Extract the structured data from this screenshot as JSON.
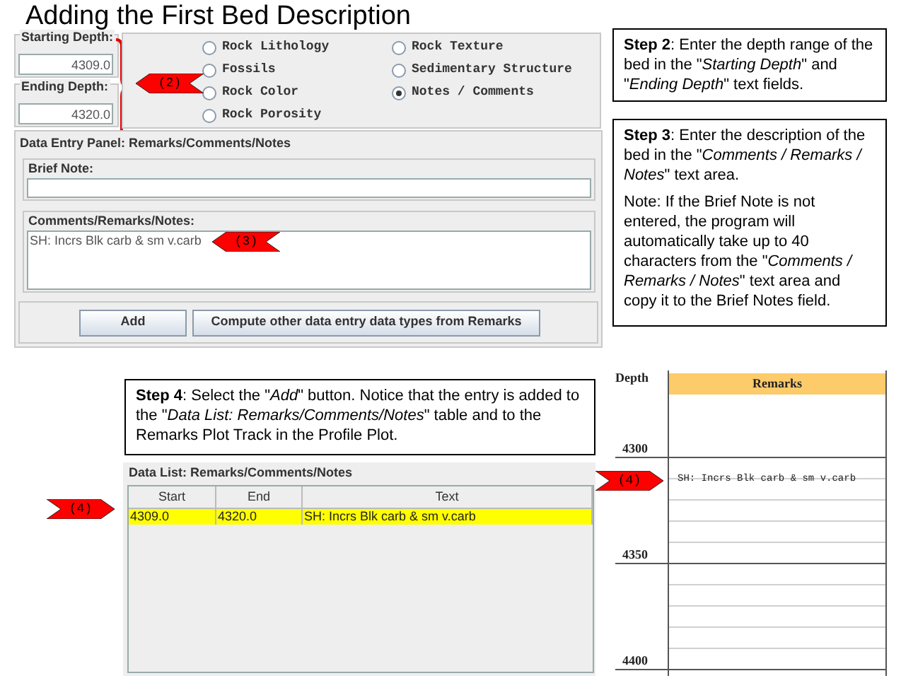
{
  "title": "Adding the First Bed Description",
  "depth_fields": [
    {
      "label": "Starting Depth:",
      "value": "4309.0"
    },
    {
      "label": "Ending Depth:",
      "value": "4320.0"
    }
  ],
  "data_types": [
    {
      "label": "Rock Lithology",
      "selected": false
    },
    {
      "label": "Fossils",
      "selected": false
    },
    {
      "label": "Rock Color",
      "selected": false
    },
    {
      "label": "Rock Porosity",
      "selected": false
    },
    {
      "label": "Rock Texture",
      "selected": false
    },
    {
      "label": "Sedimentary Structure",
      "selected": false
    },
    {
      "label": "Notes / Comments",
      "selected": true
    }
  ],
  "data_entry_panel": {
    "title": "Data Entry Panel: Remarks/Comments/Notes",
    "brief_note": {
      "label": "Brief Note:"
    },
    "comments": {
      "label": "Comments/Remarks/Notes:",
      "value": "SH: Incrs Blk carb & sm v.carb"
    }
  },
  "buttons": [
    "Add",
    "Compute other data entry data types from Remarks"
  ],
  "steps": [
    {
      "paragraphs": [
        "**Step 2**: Enter the depth range of the bed in the \"*Starting Depth*\" and \"*Ending Depth*\" text fields."
      ]
    },
    {
      "paragraphs": [
        "**Step 3**: Enter the description of the bed in the \"*Comments / Remarks / Notes*\" text area.",
        "Note: If the Brief Note is not entered, the program will automatically take up to 40 characters from the \"*Comments / Remarks / Notes*\" text area and copy it to the Brief Notes field."
      ]
    },
    {
      "paragraphs": [
        "**Step 4**: Select the \"*Add*\" button. Notice that the entry is added to the \"*Data List: Remarks/Comments/Notes*\" table and to the Remarks Plot Track in the Profile Plot."
      ]
    }
  ],
  "data_list": {
    "title": "Data List: Remarks/Comments/Notes",
    "columns": [
      "Start",
      "End",
      "Text"
    ],
    "rows": [
      {
        "cells": [
          "4309.0",
          "4320.0",
          "SH: Incrs Blk carb & sm v.carb"
        ],
        "selected": true
      }
    ]
  },
  "profile_plot": {
    "depth_header": "Depth",
    "track_header": "Remarks",
    "depth_labels": [
      "4300",
      "4350",
      "4400"
    ],
    "remark": "SH: Incrs Blk carb & sm v.carb"
  },
  "callouts": [
    "(2)",
    "(3)",
    "(4)",
    "(4)"
  ]
}
